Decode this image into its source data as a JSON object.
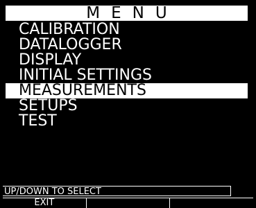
{
  "menu": {
    "title": "MENU",
    "items": [
      {
        "label": "CALIBRATION",
        "selected": false
      },
      {
        "label": "DATALOGGER",
        "selected": false
      },
      {
        "label": "DISPLAY",
        "selected": false
      },
      {
        "label": "INITIAL SETTINGS",
        "selected": false
      },
      {
        "label": "MEASUREMENTS",
        "selected": true
      },
      {
        "label": "SETUPS",
        "selected": false
      },
      {
        "label": "TEST",
        "selected": false
      }
    ]
  },
  "status": {
    "hint": "UP/DOWN TO SELECT"
  },
  "softkeys": [
    {
      "label": "EXIT"
    },
    {
      "label": ""
    },
    {
      "label": ""
    }
  ],
  "colors": {
    "background": "#000000",
    "foreground": "#ffffff",
    "highlight": "#ffffff"
  }
}
